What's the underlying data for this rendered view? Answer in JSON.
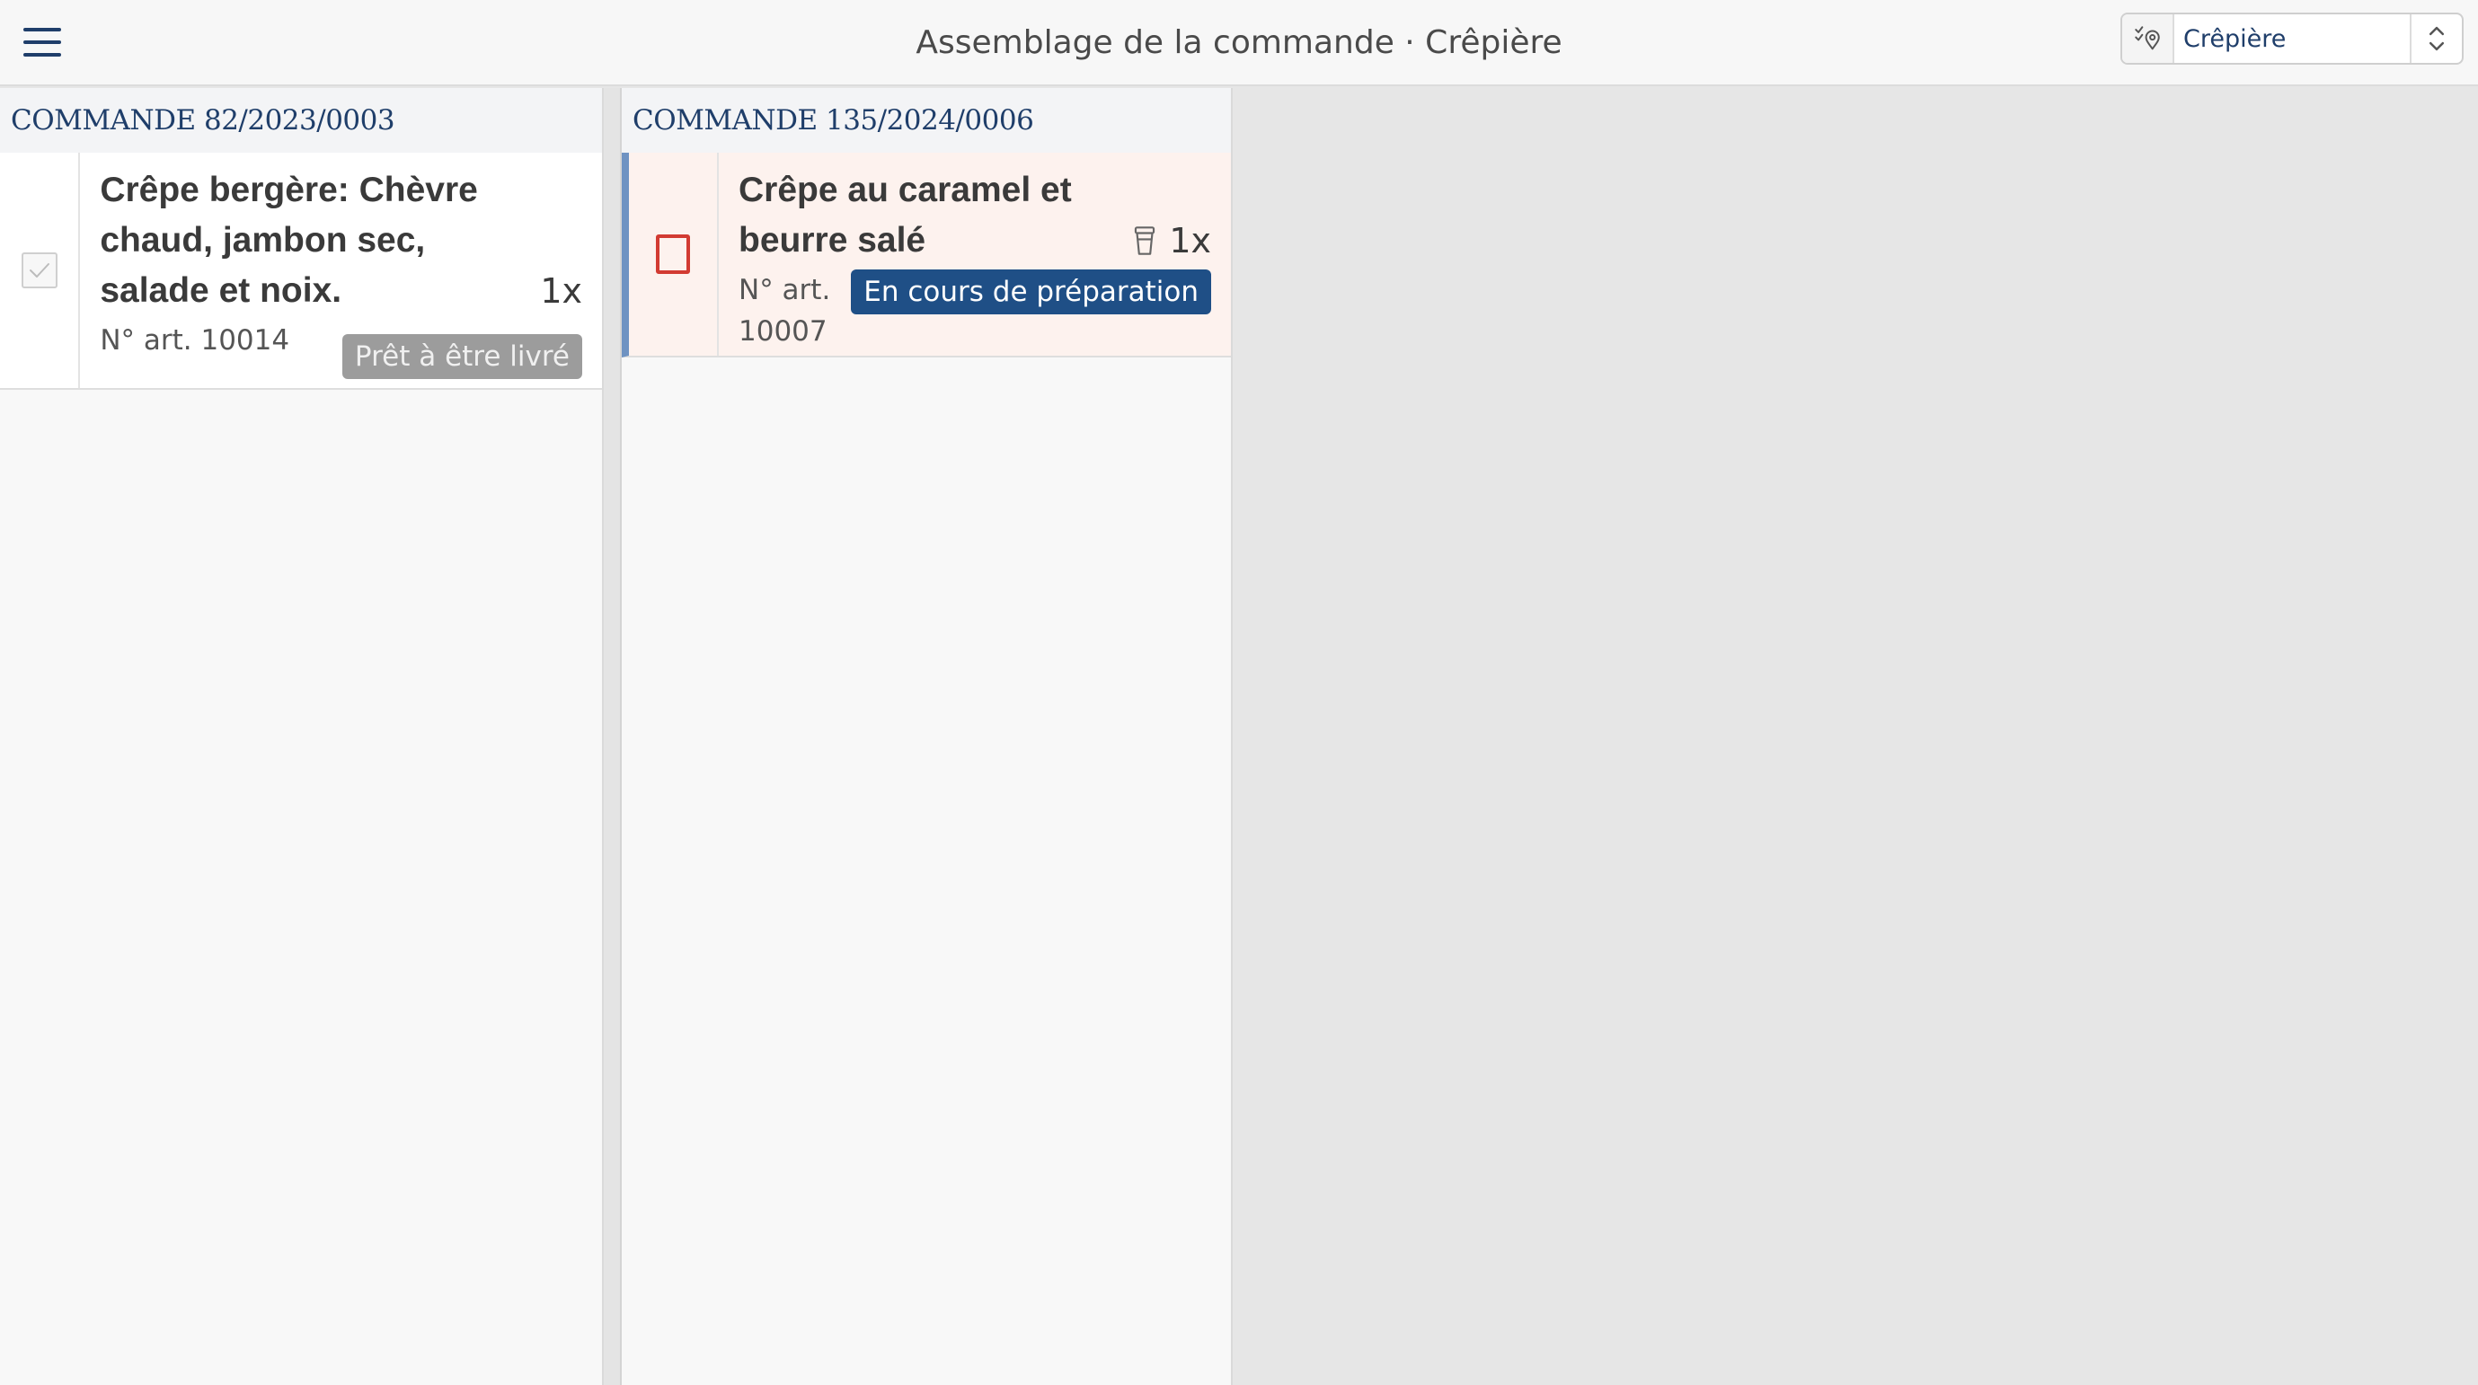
{
  "header": {
    "menu_icon": "hamburger-menu-icon",
    "title": "Assemblage de la commande · Crêpière",
    "location": {
      "icon": "location-pin-icon",
      "value": "Crêpière",
      "arrows_icon": "chevron-up-down-icon"
    }
  },
  "orders": [
    {
      "title": "COMMANDE 82/2023/0003",
      "items": [
        {
          "name": "Crêpe bergère: Chèvre chaud, jambon sec, salade et noix.",
          "quantity": "1x",
          "article": "N° art. 10014",
          "status": "Prêt à être livré",
          "checked": true
        }
      ]
    },
    {
      "title": "COMMANDE 135/2024/0006",
      "items": [
        {
          "name": "Crêpe au caramel et beurre salé",
          "quantity": "1x",
          "quantity_icon": "cup-icon",
          "article": "N° art. 10007",
          "status": "En cours de préparation",
          "checked": false
        }
      ]
    }
  ],
  "colors": {
    "accent": "#1f3e6a",
    "status_progress": "#1f4f86",
    "status_ready": "#9c9c9c",
    "unchecked_border": "#d23b32",
    "active_card_bg": "#fdf2ee",
    "active_card_border": "#6f93c2"
  }
}
